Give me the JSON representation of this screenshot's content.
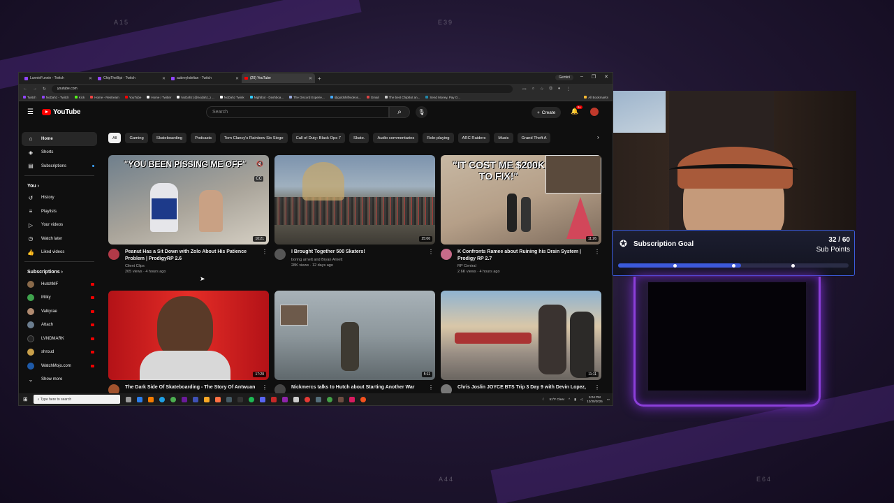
{
  "overlay": {
    "corner_labels": [
      "A15",
      "E39",
      "A44",
      "E64"
    ],
    "sub_goal": {
      "title": "Subscription Goal",
      "count": "32 / 60",
      "unit": "Sub Points",
      "progress": 0.533,
      "accent": "#3b5bdb"
    }
  },
  "browser": {
    "tabs": [
      {
        "label": "LunnieFunnie - Twitch",
        "icon": "twitch-icon"
      },
      {
        "label": "ChipTheBipi - Twitch",
        "icon": "twitch-icon"
      },
      {
        "label": "aubreykdeltan - Twitch",
        "icon": "twitch-icon"
      },
      {
        "label": "(20) YouTube",
        "icon": "youtube-icon"
      }
    ],
    "gemini_label": "Gemini",
    "url": "youtube.com",
    "bookmarks": [
      "Twitch",
      "NoDahz - Twitch",
      "Kick",
      "Home - Restream",
      "YouTube",
      "Home / Twitter",
      "NoDahz (@nodahz_) ...",
      "NoDahz Twink",
      "Nightbot - Dashboa...",
      "The Discord Experie...",
      "@goldshiftvideos...",
      "Gmail",
      "The best ChipBot an...",
      "Send Money, Pay O...",
      "All Bookmarks"
    ]
  },
  "youtube": {
    "logo": "YouTube",
    "search_placeholder": "Search",
    "create_label": "Create",
    "notif_count": "9+",
    "nav": [
      {
        "label": "Home",
        "icon": "home-icon",
        "active": true
      },
      {
        "label": "Shorts",
        "icon": "shorts-icon"
      },
      {
        "label": "Subscriptions",
        "icon": "subscriptions-icon",
        "dot": true
      }
    ],
    "you_header": "You",
    "you_items": [
      {
        "label": "History",
        "icon": "history-icon"
      },
      {
        "label": "Playlists",
        "icon": "playlists-icon"
      },
      {
        "label": "Your videos",
        "icon": "your-videos-icon"
      },
      {
        "label": "Watch later",
        "icon": "watch-later-icon"
      },
      {
        "label": "Liked videos",
        "icon": "liked-videos-icon"
      }
    ],
    "subs_header": "Subscriptions",
    "subscriptions": [
      {
        "label": "HutchMF",
        "color": "#8a6a4a"
      },
      {
        "label": "Milky",
        "color": "#3fa34d"
      },
      {
        "label": "Valkyrae",
        "color": "#b08a70"
      },
      {
        "label": "Attach",
        "color": "#6b7d8f"
      },
      {
        "label": "LVNDMARK",
        "color": "#222222"
      },
      {
        "label": "shroud",
        "color": "#c9a04a"
      },
      {
        "label": "WatchMojo.com",
        "color": "#1e5aa8"
      }
    ],
    "show_more": "Show more",
    "chips": [
      "All",
      "Gaming",
      "Skateboarding",
      "Podcasts",
      "Tom Clancy's Rainbow Six Siege",
      "Call of Duty: Black Ops 7",
      "Skate.",
      "Audio commentaries",
      "Role-playing",
      "ARC Raiders",
      "Music",
      "Grand Theft A"
    ],
    "videos": [
      {
        "title": "Peanut Has a Sit Down with Zolo About His Patience Problem | ProdigyRP 2.6",
        "channel": "Client Clips",
        "stats": "205 views · 4 hours ago",
        "duration": "10:21",
        "overlay": "\"YOU BEEN PISSING ME OFF\""
      },
      {
        "title": "I Brought Together 500 Skaters!",
        "channel": "boring arnett and Bryan Arnett",
        "stats": "28K views · 12 days ago",
        "duration": "25:06",
        "overlay": ""
      },
      {
        "title": "K Confronts Ramee about Ruining his Drain System | Prodigy RP 2.7",
        "channel": "RP Central",
        "stats": "2.6K views · 4 hours ago",
        "duration": "11:26",
        "overlay": "\"IT COST ME $200K TO FIX!\""
      },
      {
        "title": "The Dark Side Of Skateboarding - The Story Of Antwuan",
        "channel": "",
        "stats": "",
        "duration": "17:20",
        "overlay": ""
      },
      {
        "title": "Nickmercs talks to Hutch about Starting Another War",
        "channel": "",
        "stats": "",
        "duration": "5:11",
        "overlay": ""
      },
      {
        "title": "Chris Joslin JOYCE BTS Trip 3 Day 9 with Devin Lopez,",
        "channel": "",
        "stats": "",
        "duration": "11:11",
        "overlay": ""
      }
    ]
  },
  "taskbar": {
    "search_placeholder": "Type here to search",
    "weather": "51°F Clear",
    "time": "5:04 PM",
    "date": "12/30/2025"
  }
}
